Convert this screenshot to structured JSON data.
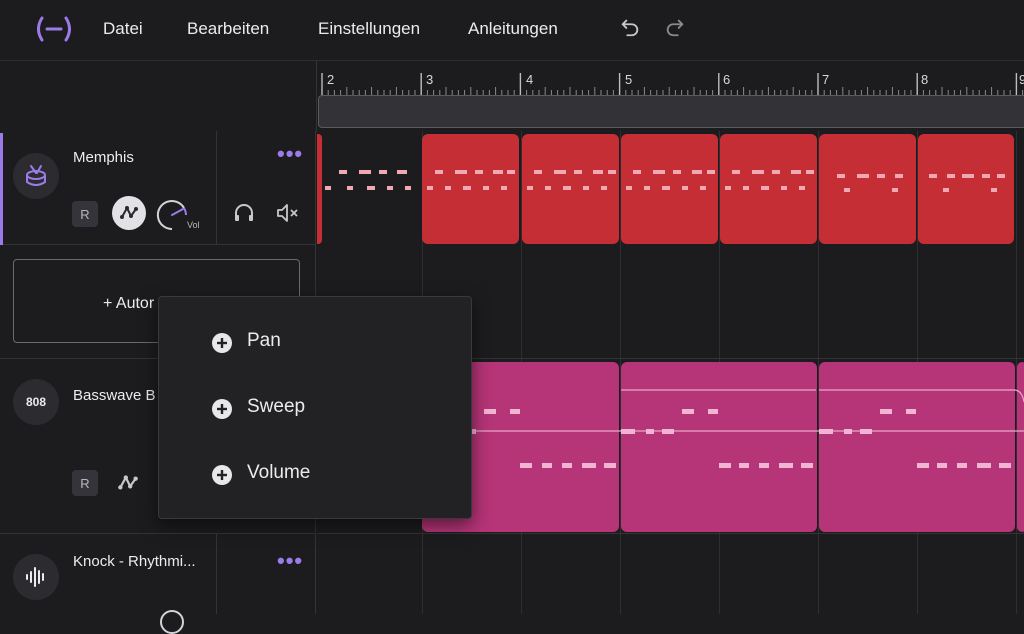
{
  "menu": {
    "items": [
      "Datei",
      "Bearbeiten",
      "Einstellungen",
      "Anleitungen"
    ],
    "logo_icon": "bracket-dash-logo-icon",
    "undo_icon": "undo-icon",
    "redo_icon": "redo-icon"
  },
  "ruler": {
    "ticks": [
      "2",
      "3",
      "4",
      "5",
      "6",
      "7",
      "8",
      "9"
    ]
  },
  "tracks": [
    {
      "name": "Memphis",
      "icon": "drum-icon",
      "record_label": "R",
      "vol_label": "Vol",
      "color": "#c62e36"
    },
    {
      "name": "Basswave B",
      "icon_text": "808",
      "record_label": "R",
      "color": "#b63478"
    },
    {
      "name": "Knock - Rhythmi...",
      "icon": "waveform-icon"
    }
  ],
  "automation_button": {
    "label": "+ Autor"
  },
  "automation_menu": {
    "items": [
      {
        "label": "Pan",
        "icon": "plus-circle-icon"
      },
      {
        "label": "Sweep",
        "icon": "plus-circle-icon"
      },
      {
        "label": "Volume",
        "icon": "plus-circle-icon"
      }
    ]
  },
  "colors": {
    "accent": "#9b7bea",
    "drum_clip": "#c62e36",
    "bass_clip": "#b63478",
    "background": "#1c1c1f"
  }
}
